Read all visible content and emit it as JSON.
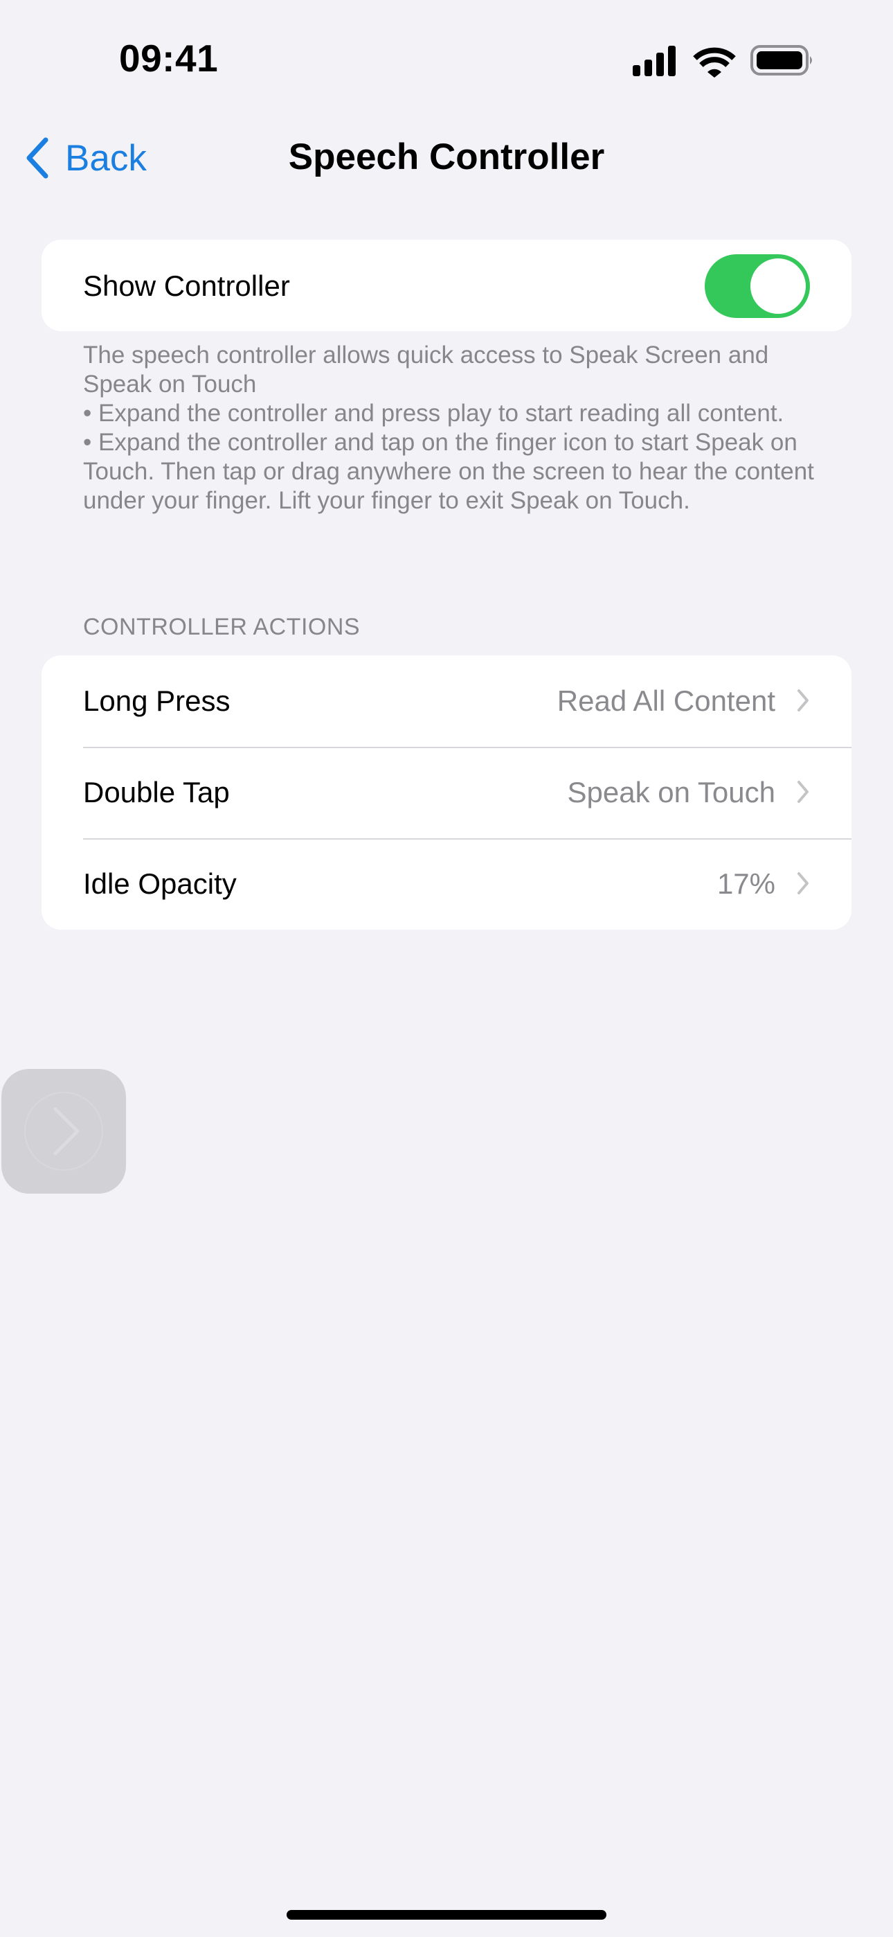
{
  "status_bar": {
    "time": "09:41",
    "icons": [
      "cellular-signal-icon",
      "wifi-icon",
      "battery-icon"
    ]
  },
  "nav": {
    "back_label": "Back",
    "title": "Speech Controller"
  },
  "show_controller": {
    "label": "Show Controller",
    "enabled": true,
    "toggle_color": "#34c759"
  },
  "description": "The speech controller allows quick access to Speak Screen and Speak on Touch\n • Expand the controller and press play to start reading all content.\n • Expand the controller and tap on the finger icon to start Speak on Touch. Then tap or drag anywhere on the screen to hear the content under your finger. Lift your finger to exit Speak on Touch.",
  "controller_actions": {
    "header": "CONTROLLER ACTIONS",
    "rows": [
      {
        "label": "Long Press",
        "value": "Read All Content"
      },
      {
        "label": "Double Tap",
        "value": "Speak on Touch"
      },
      {
        "label": "Idle Opacity",
        "value": "17%"
      }
    ]
  },
  "floating_controller": {
    "icon": "chevron-right-icon"
  },
  "colors": {
    "accent": "#1a7fe0",
    "background": "#f2f2f7",
    "secondary_text": "#86868b"
  }
}
